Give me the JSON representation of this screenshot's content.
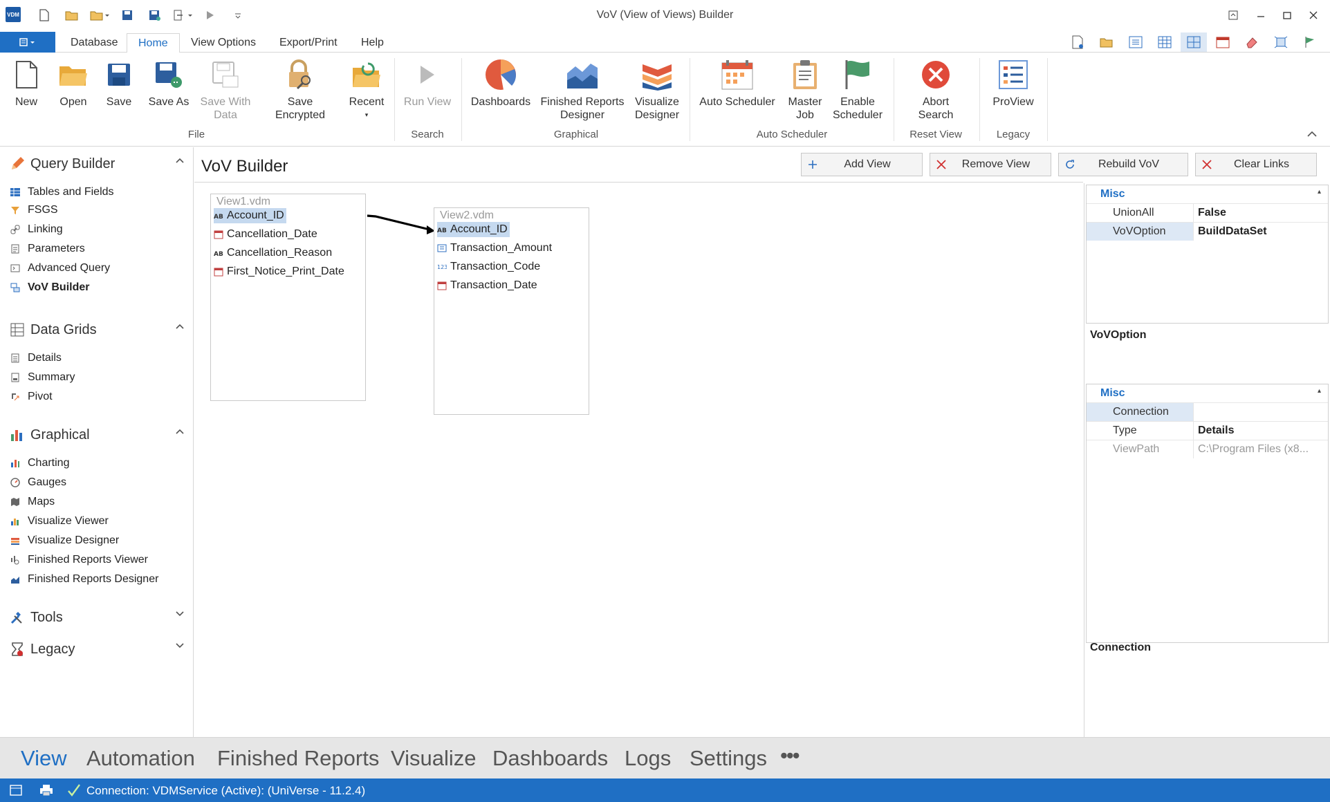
{
  "window": {
    "title": "VoV (View of Views) Builder",
    "logo": "VDM"
  },
  "ribbon_tabs": [
    {
      "label": "Database"
    },
    {
      "label": "Home"
    },
    {
      "label": "View Options"
    },
    {
      "label": "Export/Print"
    },
    {
      "label": "Help"
    }
  ],
  "ribbon": {
    "buttons": [
      {
        "label": "New",
        "icon": "new-file-icon"
      },
      {
        "label": "Open",
        "icon": "folder-open-icon"
      },
      {
        "label": "Save",
        "icon": "save-icon"
      },
      {
        "label": "Save As",
        "icon": "save-as-icon"
      },
      {
        "label": "Save With",
        "label2": "Data",
        "icon": "save-with-data-icon"
      },
      {
        "label": "Save Encrypted",
        "icon": "lock-icon"
      },
      {
        "label": "Recent",
        "icon": "recent-folder-icon"
      },
      {
        "label": "Run View",
        "icon": "play-icon"
      },
      {
        "label": "Dashboards",
        "icon": "pie-chart-icon"
      },
      {
        "label": "Finished Reports",
        "label2": "Designer",
        "icon": "area-chart-icon"
      },
      {
        "label": "Visualize",
        "label2": "Designer",
        "icon": "visualize-icon"
      },
      {
        "label": "Auto Scheduler",
        "icon": "calendar-icon"
      },
      {
        "label": "Master",
        "label2": "Job",
        "icon": "clipboard-icon"
      },
      {
        "label": "Enable",
        "label2": "Scheduler",
        "icon": "flag-icon"
      },
      {
        "label": "Abort",
        "label2": "Search",
        "icon": "abort-icon"
      },
      {
        "label": "ProView",
        "icon": "proview-icon"
      }
    ],
    "groups": [
      "File",
      "Search",
      "Graphical",
      "Auto Scheduler",
      "Reset View",
      "Legacy"
    ]
  },
  "leftnav": {
    "groups": [
      {
        "label": "Query Builder",
        "icon": "pencil-icon"
      },
      {
        "label": "Data Grids",
        "icon": "grid-icon"
      },
      {
        "label": "Graphical",
        "icon": "bar-chart-icon"
      },
      {
        "label": "Tools",
        "icon": "tools-icon"
      },
      {
        "label": "Legacy",
        "icon": "legacy-icon"
      }
    ],
    "query_builder_items": [
      "Tables and Fields",
      "FSGS",
      "Linking",
      "Parameters",
      "Advanced Query",
      "VoV Builder"
    ],
    "data_grids_items": [
      "Details",
      "Summary",
      "Pivot"
    ],
    "graphical_items": [
      "Charting",
      "Gauges",
      "Maps",
      "Visualize Viewer",
      "Visualize Designer",
      "Finished Reports Viewer",
      "Finished Reports Designer"
    ]
  },
  "main": {
    "title": "VoV Builder",
    "toolbar": {
      "add_view": "Add View",
      "remove_view": "Remove View",
      "rebuild_vov": "Rebuild VoV",
      "clear_links": "Clear Links"
    },
    "view1": {
      "title": "View1.vdm",
      "fields": [
        "Account_ID",
        "Cancellation_Date",
        "Cancellation_Reason",
        "First_Notice_Print_Date"
      ]
    },
    "view2": {
      "title": "View2.vdm",
      "fields": [
        "Account_ID",
        "Transaction_Amount",
        "Transaction_Code",
        "Transaction_Date"
      ]
    }
  },
  "properties": {
    "grid1": {
      "category": "Misc",
      "rows": [
        {
          "key": "UnionAll",
          "value": "False"
        },
        {
          "key": "VoVOption",
          "value": "BuildDataSet"
        }
      ],
      "description": "VoVOption"
    },
    "grid2": {
      "category": "Misc",
      "rows": [
        {
          "key": "Connection",
          "value": ""
        },
        {
          "key": "Type",
          "value": "Details"
        },
        {
          "key": "ViewPath",
          "value": "C:\\Program Files (x8..."
        }
      ],
      "description": "Connection"
    }
  },
  "bottomnav": [
    "View",
    "Automation",
    "Finished Reports",
    "Visualize",
    "Dashboards",
    "Logs",
    "Settings",
    "•••"
  ],
  "status": {
    "text": "Connection: VDMService (Active): (UniVerse - 11.2.4)"
  },
  "colors": {
    "accent": "#1f6fc4",
    "selection": "#c5d9ef"
  }
}
